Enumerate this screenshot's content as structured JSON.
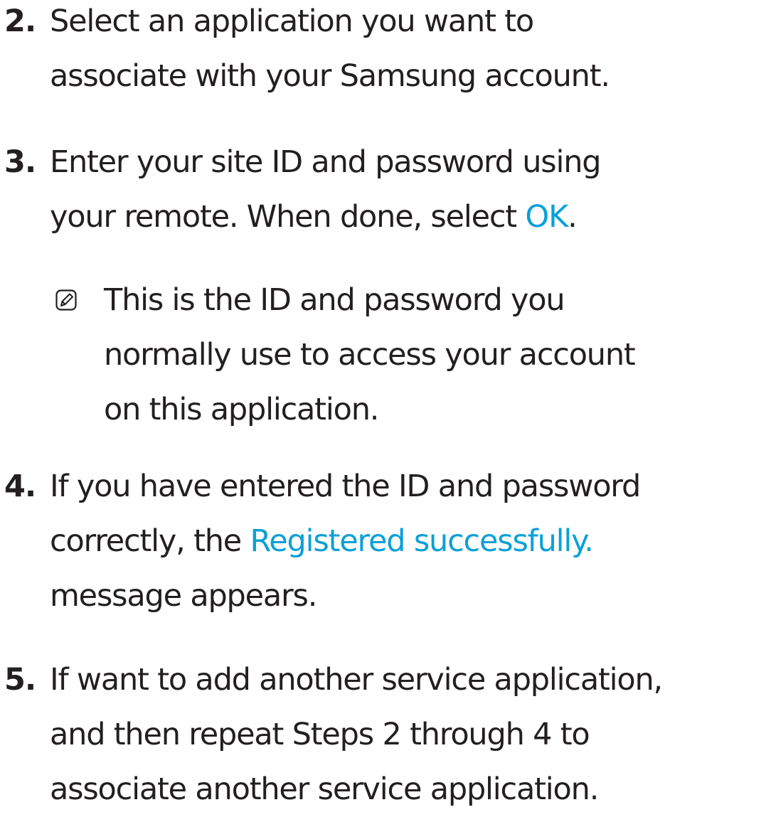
{
  "steps": [
    {
      "number": "2.",
      "lines": [
        "Select an application you want to",
        "associate with your Samsung account."
      ]
    },
    {
      "number": "3.",
      "line1": "Enter your site ID and password using",
      "line2_before": "your remote. When done, select ",
      "line2_highlight": "OK",
      "line2_after": ".",
      "note": {
        "icon": "note-icon",
        "lines": [
          "This is the ID and password you",
          "normally use to access your account",
          "on this application."
        ]
      }
    },
    {
      "number": "4.",
      "line1": "If you have entered the ID and password",
      "line2_before": "correctly, the ",
      "line2_highlight": "Registered successfully.",
      "line3": "message appears."
    },
    {
      "number": "5.",
      "lines": [
        "If want to add another service application,",
        "and then  repeat Steps 2 through 4 to",
        "associate another service application."
      ]
    }
  ],
  "colors": {
    "text": "#231f20",
    "highlight": "#0aa0d8"
  }
}
